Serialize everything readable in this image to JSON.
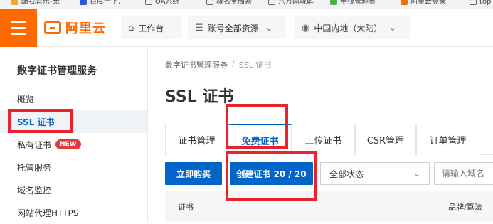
{
  "bookmarks": [
    "酷我音乐-无",
    "百度一下,",
    "OA系统",
    "域名全局索",
    "东方网域解",
    "全栈管理员",
    "阿里云登录",
    "top"
  ],
  "header": {
    "logo_text": "阿里云",
    "workbench": "工作台",
    "resources": "账号全部资源",
    "region": "中国内地（大陆）"
  },
  "sidebar": {
    "title": "数字证书管理服务",
    "items": [
      {
        "label": "概览"
      },
      {
        "label": "SSL 证书"
      },
      {
        "label": "私有证书",
        "badge": "NEW"
      },
      {
        "label": "托管服务"
      },
      {
        "label": "域名监控"
      },
      {
        "label": "网站代理HTTPS"
      }
    ]
  },
  "breadcrumb": [
    "数字证书管理服务",
    "SSL 证书"
  ],
  "page_title": "SSL 证书",
  "tabs": [
    "证书管理",
    "免费证书",
    "上传证书",
    "CSR管理",
    "订单管理"
  ],
  "actions": {
    "buy": "立即购买",
    "create": "创建证书 20 / 20",
    "status_select": "全部状态",
    "search_placeholder": "请输入域名"
  },
  "table": {
    "columns": [
      "证书",
      "品牌/算法"
    ]
  }
}
